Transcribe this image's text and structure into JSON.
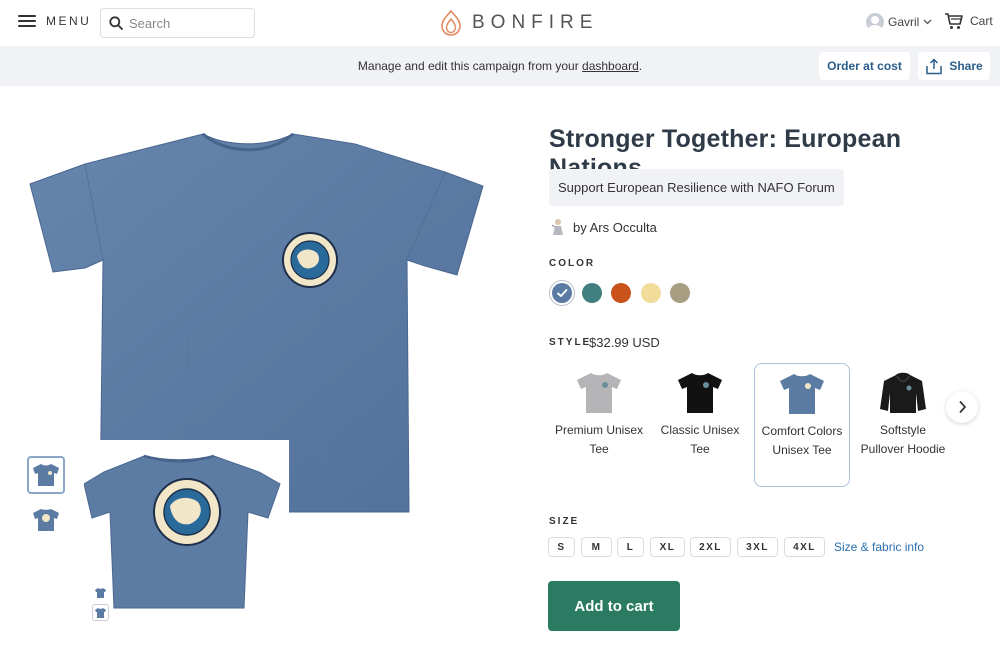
{
  "header": {
    "menu_label": "MENU",
    "search_placeholder": "Search",
    "logo_text": "BONFIRE",
    "user_name": "Gavril",
    "cart_label": "Cart"
  },
  "campaign_bar": {
    "message_prefix": "Manage and edit this campaign from your ",
    "dashboard_link": "dashboard",
    "message_suffix": ".",
    "order_at_cost": "Order at cost",
    "share": "Share"
  },
  "product": {
    "title": "Stronger Together: European Nations",
    "subtitle": "Support European Resilience with NAFO Forum",
    "author": "by Ars Occulta",
    "color_label": "COLOR",
    "colors": [
      {
        "name": "slate-blue",
        "hex": "#5b7ba3",
        "selected": true
      },
      {
        "name": "teal",
        "hex": "#3f7f80",
        "selected": false
      },
      {
        "name": "burnt-orange",
        "hex": "#c8541c",
        "selected": false
      },
      {
        "name": "butter",
        "hex": "#f2dc9a",
        "selected": false
      },
      {
        "name": "khaki",
        "hex": "#a79d80",
        "selected": false
      }
    ],
    "style_label": "STYLE",
    "price": "$32.99 USD",
    "styles": [
      {
        "name": "Premium Unisex Tee",
        "color": "#b5b5b8",
        "selected": false
      },
      {
        "name": "Classic Unisex Tee",
        "color": "#111111",
        "selected": false
      },
      {
        "name": "Comfort Colors Unisex Tee",
        "color": "#5b7ba3",
        "selected": true
      },
      {
        "name": "Softstyle Pullover Hoodie",
        "color": "#1a1a1a",
        "selected": false
      }
    ],
    "size_label": "SIZE",
    "sizes": [
      "S",
      "M",
      "L",
      "XL",
      "2XL",
      "3XL",
      "4XL"
    ],
    "size_info": "Size & fabric info",
    "add_to_cart": "Add to cart"
  },
  "colors": {
    "brand_green": "#2b7a62",
    "shirt_blue": "#5b7ba3",
    "link_blue": "#2a6fb0",
    "title_color": "#2f3b48"
  }
}
